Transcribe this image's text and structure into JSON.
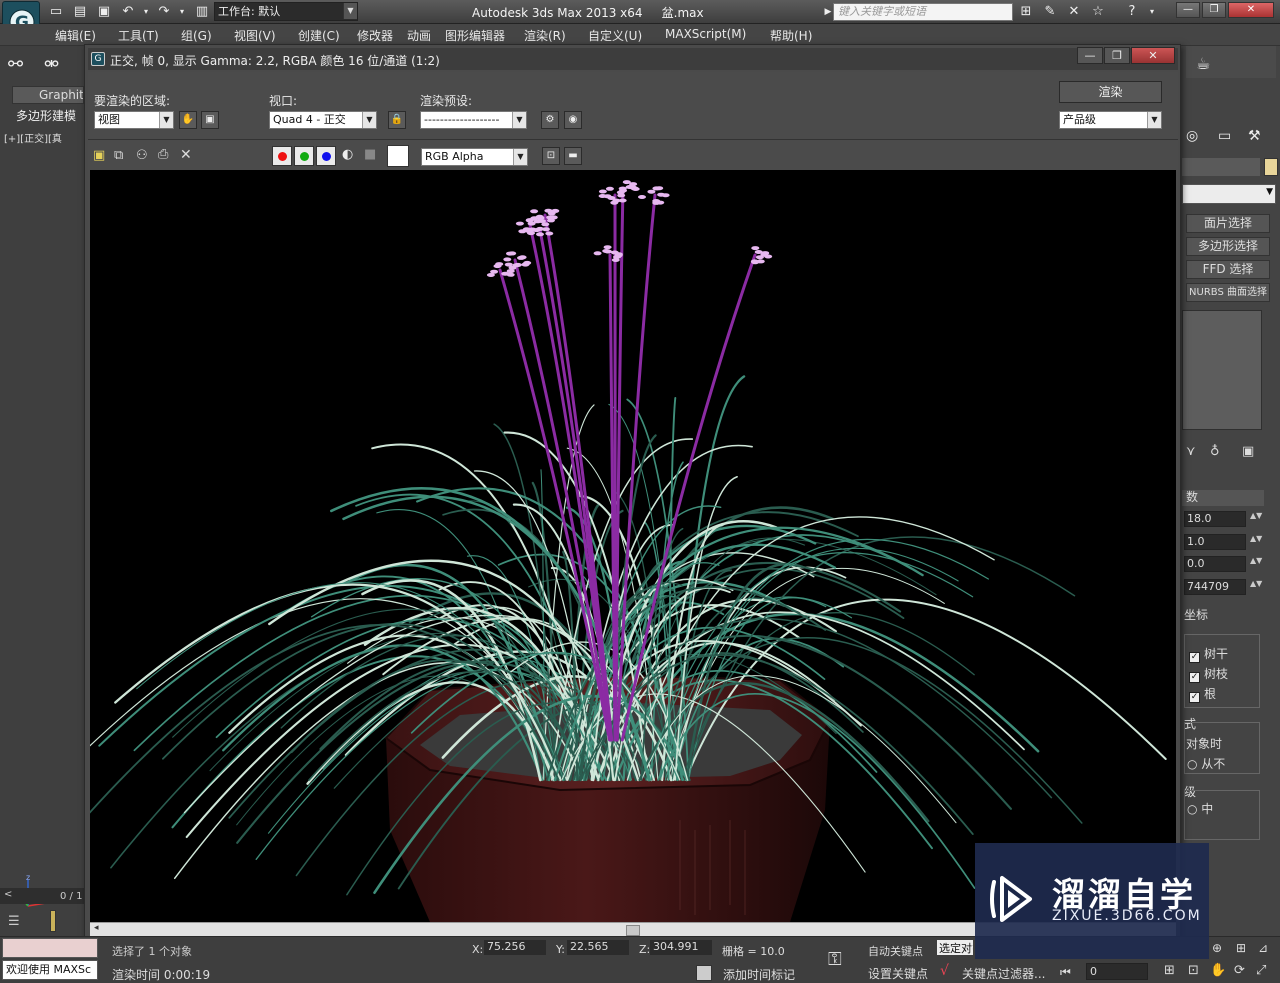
{
  "app": {
    "title": "Autodesk 3ds Max  2013 x64",
    "file": "盆.max",
    "workspace": "工作台: 默认",
    "search_placeholder": "键入关键字或短语"
  },
  "menu": [
    "编辑(E)",
    "工具(T)",
    "组(G)",
    "视图(V)",
    "创建(C)",
    "修改器",
    "动画",
    "图形编辑器",
    "渲染(R)",
    "自定义(U)",
    "MAXScript(M)",
    "帮助(H)"
  ],
  "left_panel": {
    "ribbon_tab": "Graphit",
    "ribbon_sub": "多边形建模",
    "viewport_label": "[+][正交][真",
    "timeline": "0 / 1"
  },
  "frame_window": {
    "title": "正交, 帧 0, 显示 Gamma: 2.2, RGBA 颜色 16 位/通道 (1:2)",
    "area_label": "要渲染的区域:",
    "area_value": "视图",
    "viewport_label": "视口:",
    "viewport_value": "Quad 4 - 正交",
    "preset_label": "渲染预设:",
    "preset_value": "-------------------",
    "render_button": "渲染",
    "quality_value": "产品级",
    "channel_value": "RGB Alpha"
  },
  "right_panel": {
    "buttons": [
      "面片选择",
      "多边形选择",
      "FFD 选择",
      "NURBS 曲面选择"
    ],
    "section_title": "数",
    "values": [
      "18.0",
      "1.0",
      "0.0",
      "744709"
    ],
    "coord_label": "坐标",
    "checkboxes": [
      "树干",
      "树枝",
      "根"
    ],
    "mode_label": "式",
    "mode_sub": "对象时",
    "mode_radio": "从不",
    "level_label": "级",
    "level_radio": "中"
  },
  "status": {
    "welcome": "欢迎使用 MAXSc",
    "selected": "选择了 1 个对象",
    "render_time": "渲染时间  0:00:19",
    "x_label": "X:",
    "x_value": "75.256",
    "y_label": "Y:",
    "y_value": "22.565",
    "z_label": "Z:",
    "z_value": "304.991",
    "grid": "栅格 = 10.0",
    "add_marker": "添加时间标记",
    "auto_key": "自动关键点",
    "set_key": "设置关键点",
    "key_filter": "关键点过滤器...",
    "frame": "0",
    "selected_set": "选定对象"
  },
  "watermark": {
    "brand": "溜溜自学",
    "url": "ZIXUE.3D66.COM"
  },
  "colors": {
    "pot": "#3e1414",
    "grass": "#3f8e7a",
    "stem": "#8b2ba3",
    "flower": "#e7b8f0",
    "watermark_bg": "#1e2a4e"
  }
}
